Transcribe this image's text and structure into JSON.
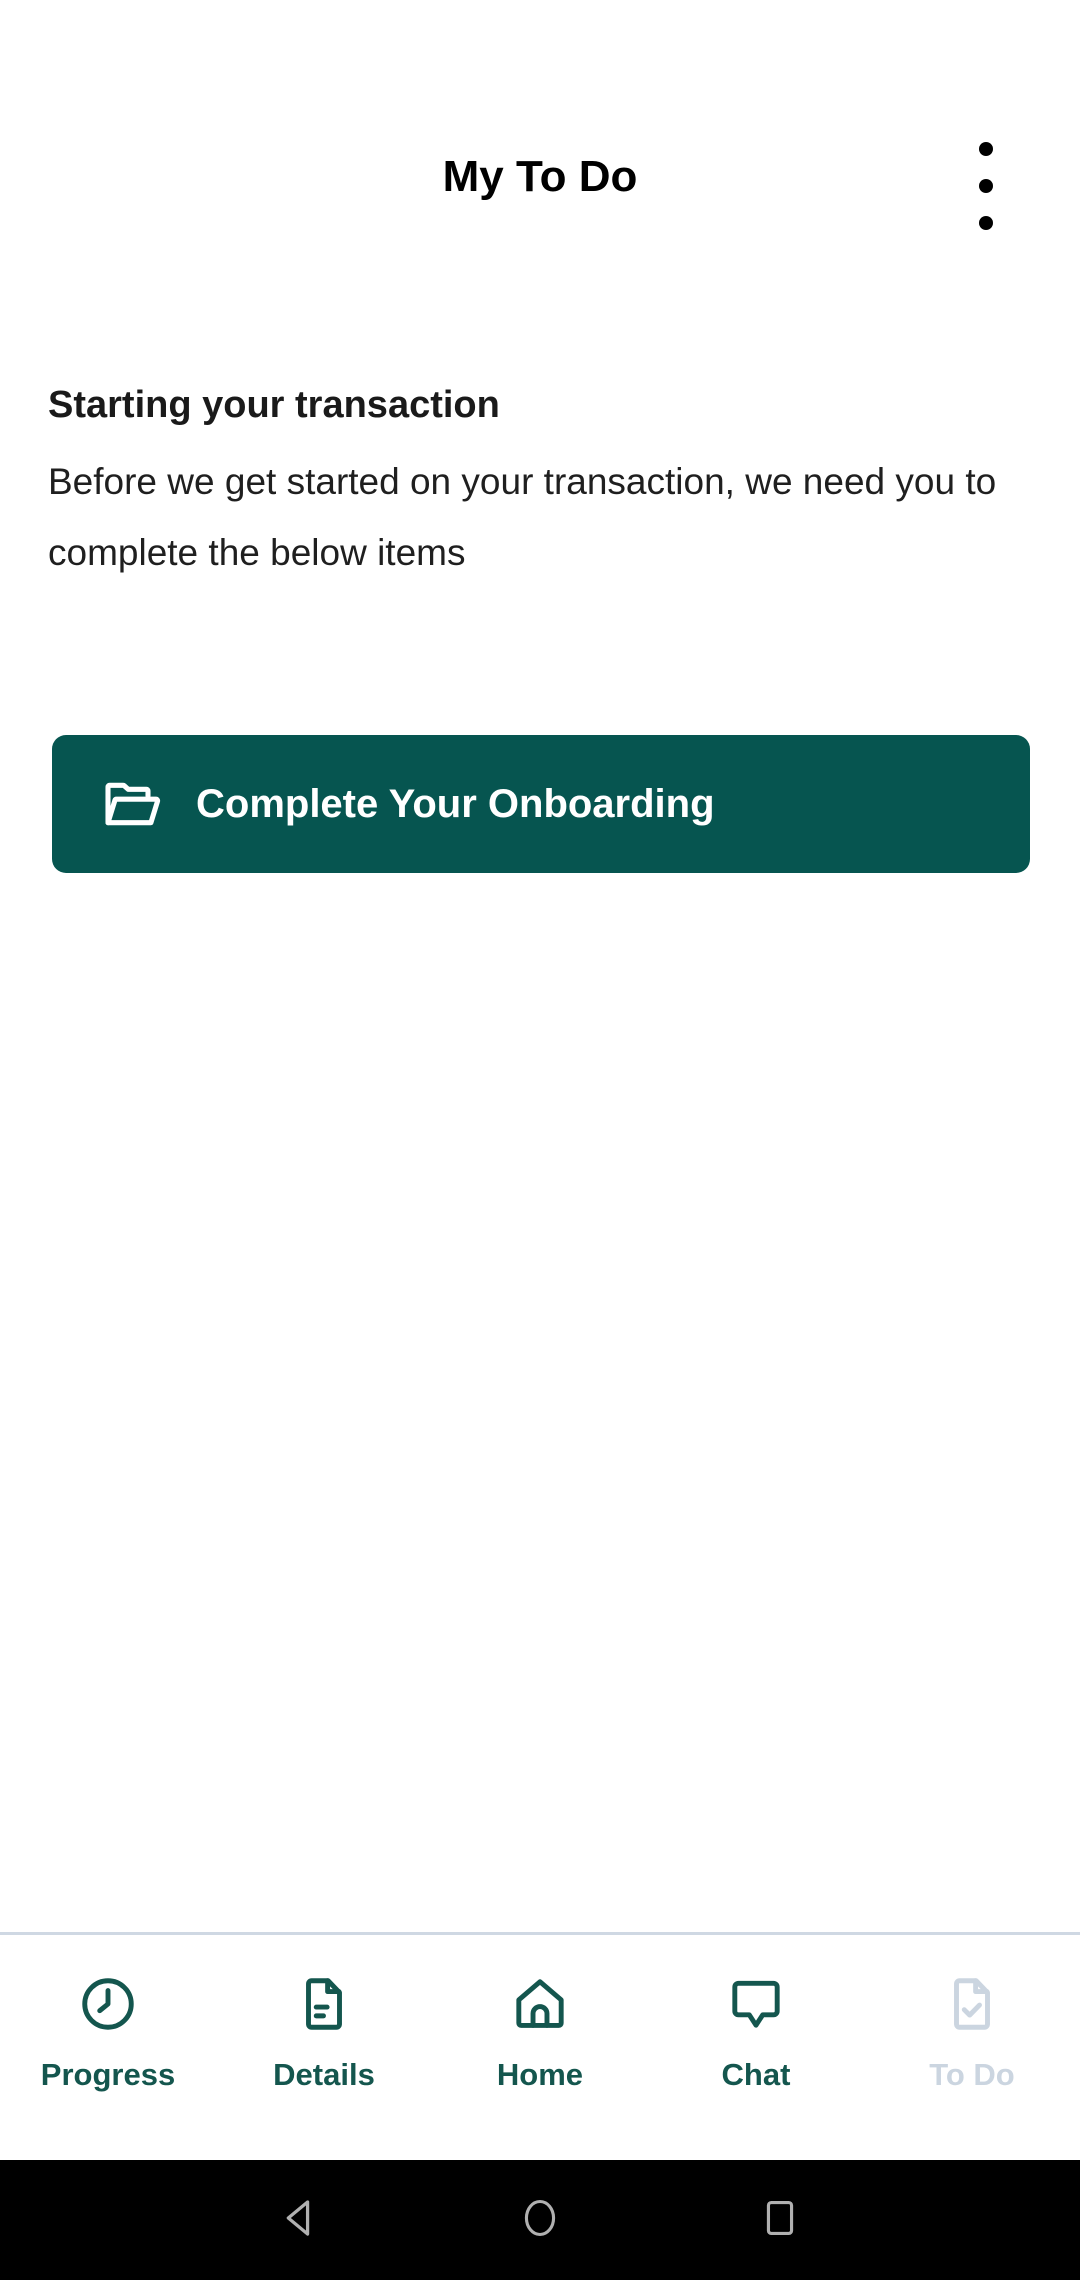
{
  "appbar": {
    "title": "My To Do",
    "overflow_menu_name": "more-options"
  },
  "content": {
    "heading": "Starting your transaction",
    "body": "Before we get started on your transaction, we need you to complete the below items"
  },
  "primary_action": {
    "label": "Complete Your Onboarding",
    "icon": "open-folder-icon",
    "background_color": "#065550",
    "text_color": "#FFFFFF"
  },
  "tabbar": {
    "accent_color": "#14564E",
    "disabled_color": "#CBD5E0",
    "divider_color": "#CFD8E3",
    "items": [
      {
        "label": "Progress",
        "icon": "clock-icon",
        "state": "enabled"
      },
      {
        "label": "Details",
        "icon": "document-icon",
        "state": "enabled"
      },
      {
        "label": "Home",
        "icon": "house-icon",
        "state": "enabled"
      },
      {
        "label": "Chat",
        "icon": "speech-bubble-icon",
        "state": "enabled"
      },
      {
        "label": "To Do",
        "icon": "document-check-icon",
        "state": "disabled"
      }
    ]
  },
  "system_nav": {
    "background_color": "#000000",
    "icon_color": "#B0B0B0",
    "buttons": [
      {
        "name": "back",
        "icon": "triangle-left-icon"
      },
      {
        "name": "home",
        "icon": "circle-icon"
      },
      {
        "name": "recents",
        "icon": "square-icon"
      }
    ]
  }
}
